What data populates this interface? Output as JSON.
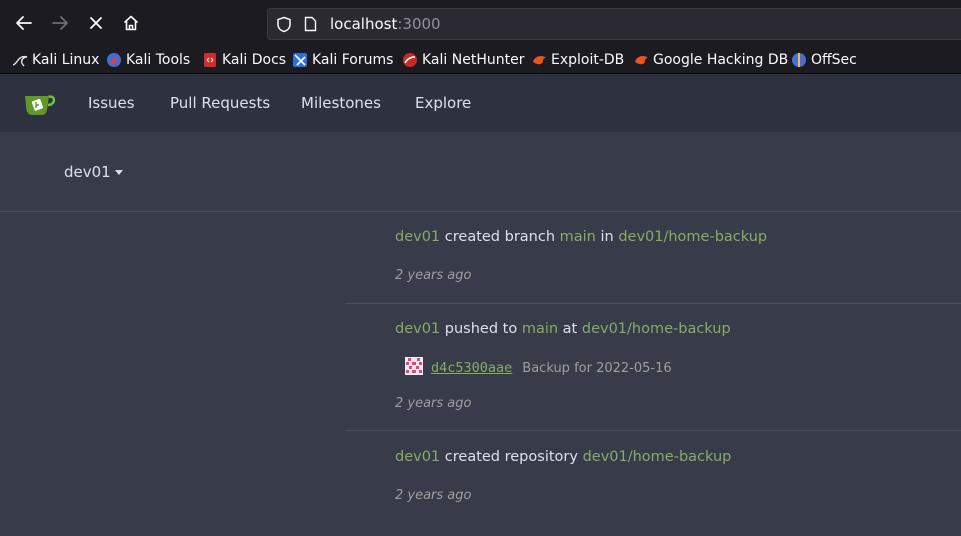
{
  "browser": {
    "url_host": "localhost",
    "url_port": ":3000",
    "bookmarks": [
      {
        "label": "Kali Linux",
        "icon": "kali-dragon-icon"
      },
      {
        "label": "Kali Tools",
        "icon": "kali-tools-icon"
      },
      {
        "label": "Kali Docs",
        "icon": "kali-docs-icon"
      },
      {
        "label": "Kali Forums",
        "icon": "kali-forums-icon"
      },
      {
        "label": "Kali NetHunter",
        "icon": "kali-nethunter-icon"
      },
      {
        "label": "Exploit-DB",
        "icon": "exploit-db-icon"
      },
      {
        "label": "Google Hacking DB",
        "icon": "ghdb-icon"
      },
      {
        "label": "OffSec",
        "icon": "offsec-icon"
      }
    ]
  },
  "header": {
    "logo": "gitea-logo-icon",
    "nav": [
      "Issues",
      "Pull Requests",
      "Milestones",
      "Explore"
    ]
  },
  "context": {
    "user": "dev01"
  },
  "feed": [
    {
      "actor": "dev01",
      "action": "created branch",
      "target": "main",
      "prep": "in",
      "repo": "dev01/home-backup",
      "time": "2 years ago"
    },
    {
      "actor": "dev01",
      "action": "pushed to",
      "target": "main",
      "prep": "at",
      "repo": "dev01/home-backup",
      "commit_sha": "d4c5300aae",
      "commit_message": "Backup for 2022-05-16",
      "time": "2 years ago"
    },
    {
      "actor": "dev01",
      "action": "created repository",
      "repo": "dev01/home-backup",
      "time": "2 years ago"
    }
  ],
  "colors": {
    "accent_link": "#87ab63",
    "page_bg": "#383c4a",
    "header_bg": "#2e323e",
    "browser_bg": "#1c1b22"
  }
}
